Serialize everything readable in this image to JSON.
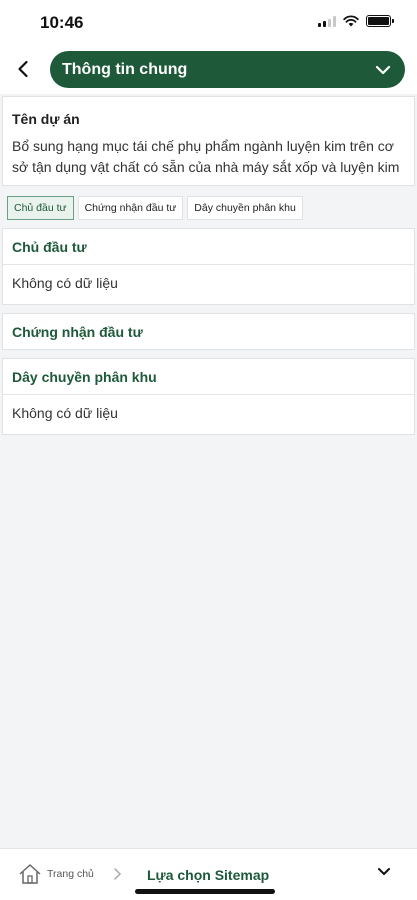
{
  "status_bar": {
    "time": "10:46"
  },
  "header": {
    "title": "Thông tin chung"
  },
  "project": {
    "label": "Tên dự án",
    "description": "Bổ sung hạng mục tái chế phụ phẩm ngành luyện kim trên cơ sở tận dụng vật chất có sẵn của nhà máy sắt xốp và luyện kim"
  },
  "tabs": [
    {
      "label": "Chủ đầu tư",
      "active": true
    },
    {
      "label": "Chứng nhận đầu tư",
      "active": false
    },
    {
      "label": "Dây chuyền phân khu",
      "active": false
    }
  ],
  "sections": [
    {
      "title": "Chủ đầu tư",
      "empty_text": "Không có dữ liệu"
    },
    {
      "title": "Chứng nhận đầu tư"
    },
    {
      "title": "Dây chuyền phân khu",
      "empty_text": "Không có dữ liệu"
    }
  ],
  "bottom_bar": {
    "home_label": "Trang chủ",
    "sitemap_label": "Lựa chọn Sitemap"
  },
  "colors": {
    "accent": "#1e5a3a",
    "background": "#f2f4f6"
  }
}
